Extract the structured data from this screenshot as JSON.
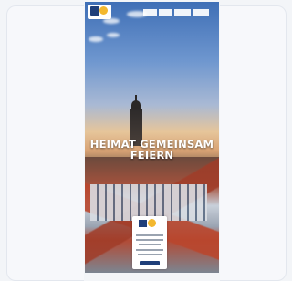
{
  "page": {
    "headline_line1": "HEIMAT GEMEINSAM",
    "headline_line2": "FEIERN"
  },
  "nav": {
    "items": [
      "",
      "",
      "",
      ""
    ]
  },
  "icons": {
    "logo": "town-logo-icon",
    "badge_logo": "town-badge-logo-icon"
  },
  "colors": {
    "brand_blue": "#1f3f7a",
    "brand_yellow": "#f3b82f"
  }
}
